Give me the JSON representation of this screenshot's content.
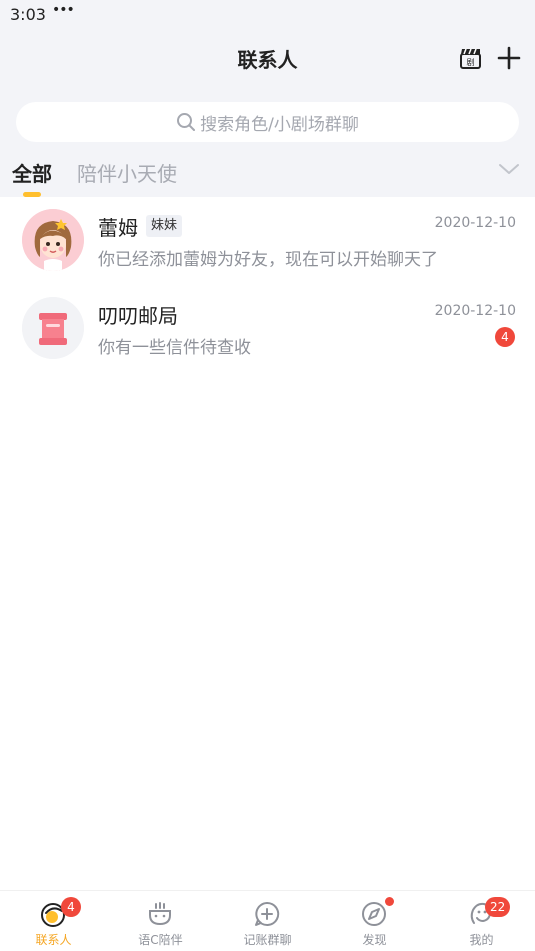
{
  "status_bar": {
    "time": "3:03",
    "dots": "•••"
  },
  "header": {
    "title": "联系人"
  },
  "search": {
    "placeholder": "搜索角色/小剧场群聊"
  },
  "tabs": {
    "all": "全部",
    "angel": "陪伴小天使"
  },
  "contacts": [
    {
      "name": "蕾姆",
      "tag": "妹妹",
      "date": "2020-12-10",
      "message": "你已经添加蕾姆为好友，现在可以开始聊天了"
    },
    {
      "name": "叨叨邮局",
      "date": "2020-12-10",
      "message": "你有一些信件待查收",
      "unread": "4"
    }
  ],
  "bottom_nav": [
    {
      "label": "联系人",
      "badge": "4",
      "icon": "contacts-icon",
      "active": true
    },
    {
      "label": "语C陪伴",
      "icon": "companion-icon"
    },
    {
      "label": "记账群聊",
      "icon": "group-chat-icon"
    },
    {
      "label": "发现",
      "icon": "compass-icon",
      "dot": true
    },
    {
      "label": "我的",
      "badge": "22",
      "icon": "profile-icon"
    }
  ],
  "colors": {
    "accent": "#ffbf2e",
    "badge": "#f0483b",
    "active_label": "#f5a623",
    "muted": "#8e9199"
  }
}
